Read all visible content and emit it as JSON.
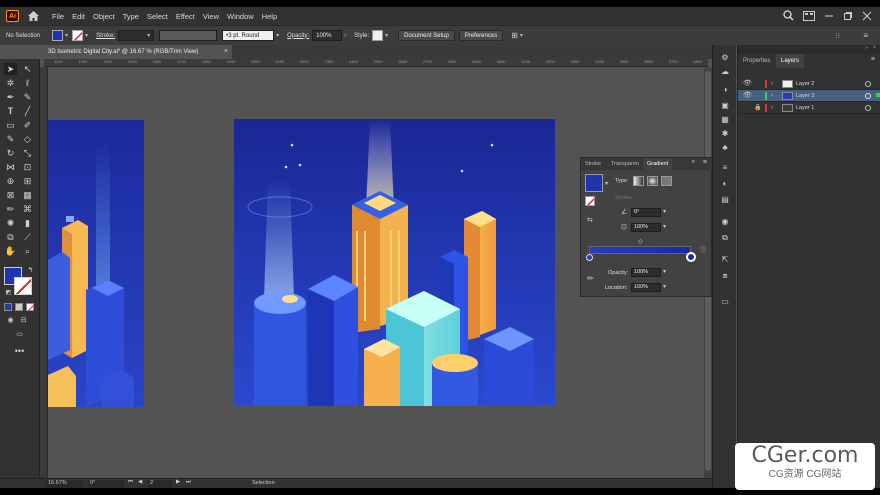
{
  "app": {
    "logo": "Ai",
    "menu": [
      "File",
      "Edit",
      "Object",
      "Type",
      "Select",
      "Effect",
      "View",
      "Window",
      "Help"
    ]
  },
  "control_bar": {
    "selection_label": "No Selection",
    "stroke_label": "Stroke:",
    "brush_value": "3 pt. Round",
    "opacity_label": "Opacity:",
    "opacity_value": "100%",
    "style_label": "Style:",
    "doc_setup_label": "Document Setup",
    "preferences_label": "Preferences"
  },
  "document_tab": {
    "title": "3D Isometric Digital City.ai* @ 16.67 % (RGB/Trim View)"
  },
  "rulers": {
    "top_ticks": [
      "1200",
      "1300",
      "1400",
      "1500",
      "1600",
      "1700",
      "1800",
      "1900",
      "2000",
      "2100",
      "2200",
      "2300",
      "2400",
      "2500",
      "2600",
      "2700",
      "2800",
      "2900",
      "3000",
      "3100",
      "3200",
      "3300",
      "3400",
      "3500",
      "3600",
      "3700",
      "3800"
    ]
  },
  "panels": {
    "properties_tab": "Properties",
    "layers_tab": "Layers",
    "layers": [
      {
        "name": "Layer 2",
        "color": "#e2313a",
        "selected": false,
        "locked": false
      },
      {
        "name": "Layer 3",
        "color": "#46c46e",
        "selected": true,
        "locked": false
      },
      {
        "name": "Layer 1",
        "color": "#e2313a",
        "selected": false,
        "locked": true
      }
    ]
  },
  "gradient_panel": {
    "tabs": [
      "Stroke",
      "Transparen",
      "Gradient"
    ],
    "type_label": "Type:",
    "stroke_label": "Stroke:",
    "angle_value": "0°",
    "aspect_value": "100%",
    "opacity_label": "Opacity:",
    "opacity_value": "100%",
    "location_label": "Location:",
    "location_value": "100%",
    "gradient_start": "#233ab8",
    "gradient_end": "#1a2aa0"
  },
  "status_bar": {
    "zoom": "16.67%",
    "rotation": "0°",
    "artboard_number": "2",
    "mode": "Selection"
  },
  "colors": {
    "fill_swatch": "#2034b0",
    "artboard_bg": "#2436b4",
    "accent": "#5b8ad8"
  },
  "watermark": {
    "title": "CGer.com",
    "subtitle": "CG资源 CG网站"
  }
}
